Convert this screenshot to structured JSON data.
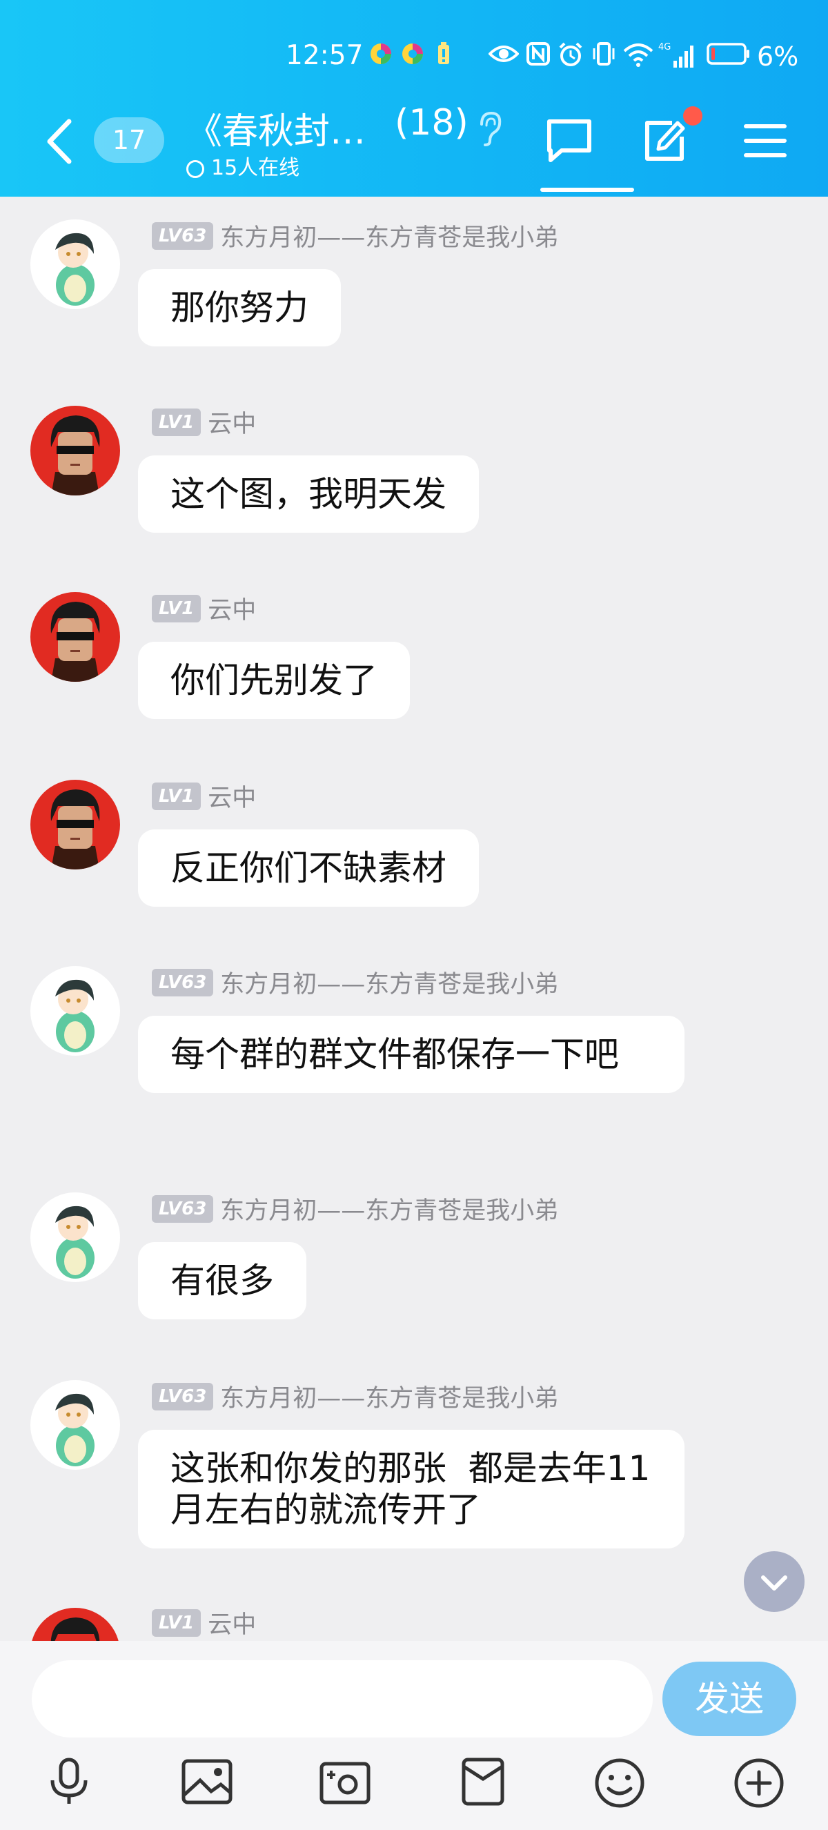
{
  "status_bar": {
    "time": "12:57",
    "battery_percent": "6%",
    "icons": [
      "app-notify-icon",
      "app-notify-icon",
      "battery-alert-icon",
      "eye-icon",
      "nfc-icon",
      "alarm-icon",
      "vibrate-icon",
      "wifi-icon",
      "signal-4g-icon",
      "battery-icon"
    ]
  },
  "header": {
    "unread_count": "17",
    "group_title": "《春秋封…",
    "member_count": "(18)",
    "online_status": "15人在线"
  },
  "messages": [
    {
      "level": "LV63",
      "nickname": "东方月初——东方青苍是我小弟",
      "text": "那你努力",
      "avatar": "green-dino-avatar"
    },
    {
      "level": "LV1",
      "nickname": "云中",
      "text": "这个图，我明天发",
      "avatar": "sunglasses-man-avatar"
    },
    {
      "level": "LV1",
      "nickname": "云中",
      "text": "你们先别发了",
      "avatar": "sunglasses-man-avatar"
    },
    {
      "level": "LV1",
      "nickname": "云中",
      "text": "反正你们不缺素材",
      "avatar": "sunglasses-man-avatar"
    },
    {
      "level": "LV63",
      "nickname": "东方月初——东方青苍是我小弟",
      "text": "每个群的群文件都保存一下吧",
      "avatar": "green-dino-avatar"
    },
    {
      "level": "LV63",
      "nickname": "东方月初——东方青苍是我小弟",
      "text": "有很多",
      "avatar": "green-dino-avatar"
    },
    {
      "level": "LV63",
      "nickname": "东方月初——东方青苍是我小弟",
      "text": "这张和你发的那张  都是去年11月左右的就流传开了",
      "avatar": "green-dino-avatar"
    },
    {
      "level": "LV1",
      "nickname": "云中",
      "text": "",
      "avatar": "sunglasses-man-avatar"
    }
  ],
  "input": {
    "placeholder": "",
    "send_label": "发送"
  },
  "toolbar": [
    "microphone-icon",
    "image-icon",
    "camera-icon",
    "red-packet-icon",
    "emoji-icon",
    "plus-icon"
  ],
  "colors": {
    "header": "#12b6f5",
    "background": "#efeff1",
    "send_button": "#7ec8f4",
    "badge_dot": "#ff5a4a"
  }
}
